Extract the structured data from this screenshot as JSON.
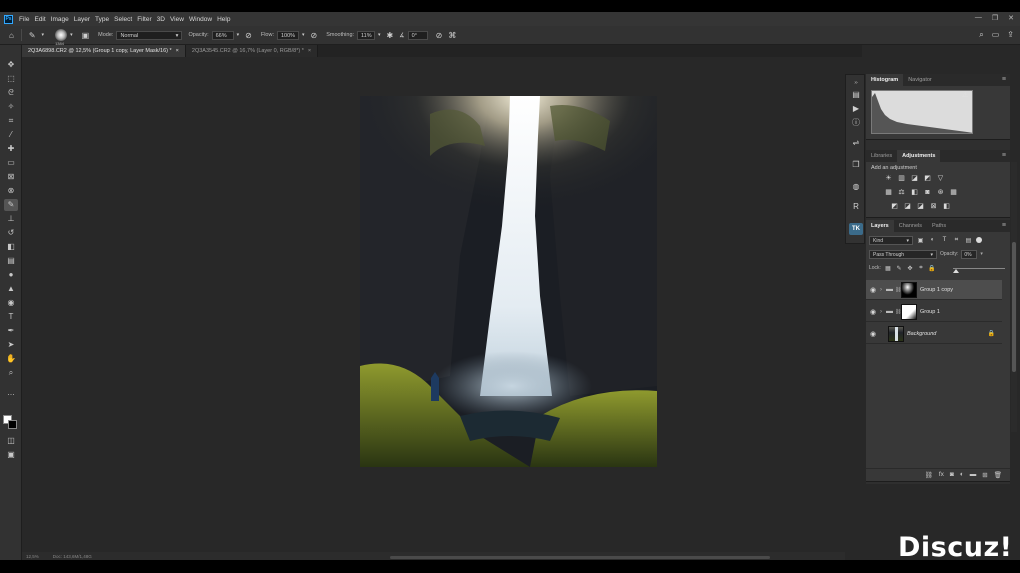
{
  "menubar": {
    "items": [
      "File",
      "Edit",
      "Image",
      "Layer",
      "Type",
      "Select",
      "Filter",
      "3D",
      "View",
      "Window",
      "Help"
    ]
  },
  "options": {
    "brush_size": "1384",
    "mode_label": "Mode:",
    "mode_value": "Normal",
    "opacity_label": "Opacity:",
    "opacity_value": "66%",
    "flow_label": "Flow:",
    "flow_value": "100%",
    "smoothing_label": "Smoothing:",
    "smoothing_value": "11%",
    "angle_value": "0°"
  },
  "tabs": [
    {
      "label": "2Q3A6898.CR2 @ 12,5% (Group 1 copy, Layer Mask/16) *",
      "close": "×"
    },
    {
      "label": "2Q3A3545.CR2 @ 16,7% (Layer 0, RGB/8*) *",
      "close": "×"
    }
  ],
  "panels": {
    "histogram_tab": "Histogram",
    "navigator_tab": "Navigator",
    "libraries_tab": "Libraries",
    "adjustments_tab": "Adjustments",
    "add_adjustment": "Add an adjustment",
    "layers_tab": "Layers",
    "channels_tab": "Channels",
    "paths_tab": "Paths",
    "kind_label": "Kind",
    "blend_mode": "Pass Through",
    "opacity_label": "Opacity:",
    "opacity_value": "0%",
    "lock_label": "Lock:"
  },
  "layers": [
    {
      "name": "Group 1 copy",
      "selected": true,
      "type": "group"
    },
    {
      "name": "Group 1",
      "selected": false,
      "type": "group"
    },
    {
      "name": "Background",
      "selected": false,
      "type": "background"
    }
  ],
  "status": {
    "zoom": "12,5%",
    "doc": "Doc: 143,6M/1,48G"
  },
  "watermark": "Discuz!",
  "colors": {
    "accent": "#31a8ff",
    "panel_bg": "#383838",
    "app_bg": "#282828"
  }
}
